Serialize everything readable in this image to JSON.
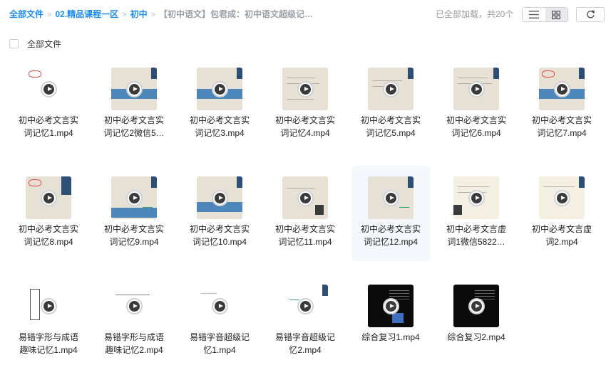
{
  "breadcrumb": {
    "items": [
      "全部文件",
      "02.精品课程一区",
      "初中"
    ],
    "current": "【初中语文】包君成：初中语文超级记…"
  },
  "status": "已全部加载，共20个",
  "icons": {
    "list_view": "list-icon",
    "grid_view": "grid-icon",
    "refresh": "refresh-icon",
    "play": "play-icon"
  },
  "select_all": {
    "label": "全部文件"
  },
  "colors": {
    "accent": "#1a8cf0",
    "hover_tile": "#f4f7fb"
  },
  "files": [
    {
      "line1": "初中必考文言实",
      "line2": "词记忆1.mp4",
      "thumb": "white"
    },
    {
      "line1": "初中必考文言实",
      "line2": "词记忆2微信5…",
      "thumb": "beige"
    },
    {
      "line1": "初中必考文言实",
      "line2": "词记忆3.mp4",
      "thumb": "beige"
    },
    {
      "line1": "初中必考文言实",
      "line2": "词记忆4.mp4",
      "thumb": "beige"
    },
    {
      "line1": "初中必考文言实",
      "line2": "词记忆5.mp4",
      "thumb": "beige"
    },
    {
      "line1": "初中必考文言实",
      "line2": "词记忆6.mp4",
      "thumb": "beige"
    },
    {
      "line1": "初中必考文言实",
      "line2": "词记忆7.mp4",
      "thumb": "beige"
    },
    {
      "line1": "初中必考文言实",
      "line2": "词记忆8.mp4",
      "thumb": "beige"
    },
    {
      "line1": "初中必考文言实",
      "line2": "词记忆9.mp4",
      "thumb": "beige"
    },
    {
      "line1": "初中必考文言实",
      "line2": "词记忆10.mp4",
      "thumb": "beige"
    },
    {
      "line1": "初中必考文言实",
      "line2": "词记忆11.mp4",
      "thumb": "beige"
    },
    {
      "line1": "初中必考文言实",
      "line2": "词记忆12.mp4",
      "thumb": "beige"
    },
    {
      "line1": "初中必考文言虚",
      "line2": "词1微信5822…",
      "thumb": "cream"
    },
    {
      "line1": "初中必考文言虚",
      "line2": "词2.mp4",
      "thumb": "cream"
    },
    {
      "line1": "易错字形与成语",
      "line2": "趣味记忆1.mp4",
      "thumb": "white"
    },
    {
      "line1": "易错字形与成语",
      "line2": "趣味记忆2.mp4",
      "thumb": "white"
    },
    {
      "line1": "易错字音超级记",
      "line2": "忆1.mp4",
      "thumb": "white"
    },
    {
      "line1": "易错字音超级记",
      "line2": "忆2.mp4",
      "thumb": "white"
    },
    {
      "line1": "综合复习1.mp4",
      "line2": "",
      "thumb": "dark"
    },
    {
      "line1": "综合复习2.mp4",
      "line2": "",
      "thumb": "dark"
    }
  ]
}
